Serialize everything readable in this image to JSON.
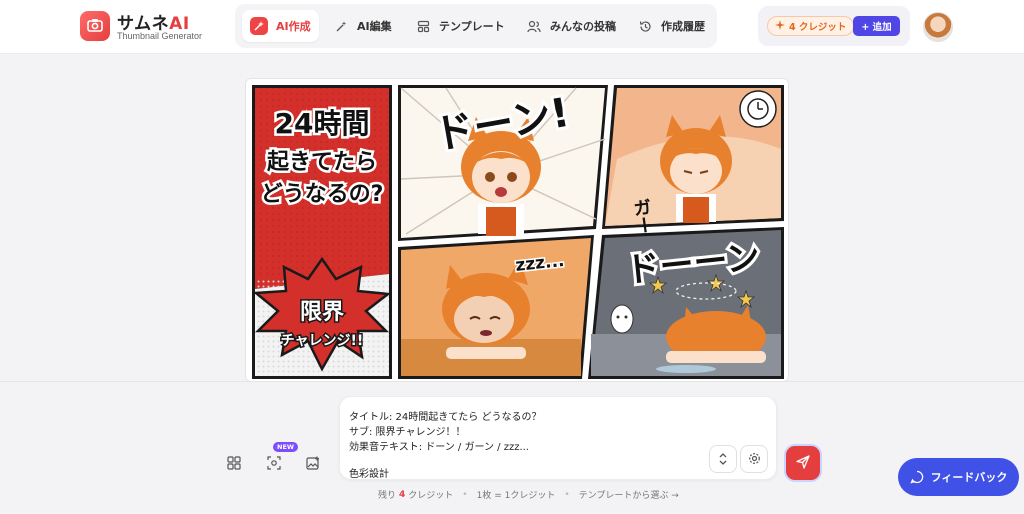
{
  "brand": {
    "title_main": "サムネ",
    "title_accent": "AI",
    "subtitle": "Thumbnail Generator",
    "logo_icon": "camera-icon",
    "accent_color": "#e53e3e"
  },
  "nav": {
    "items": [
      {
        "label": "AI作成",
        "icon": "sparkle-wand-icon",
        "active": true
      },
      {
        "label": "AI編集",
        "icon": "magic-wand-icon",
        "active": false
      },
      {
        "label": "テンプレート",
        "icon": "template-icon",
        "active": false
      },
      {
        "label": "みんなの投稿",
        "icon": "users-icon",
        "active": false
      },
      {
        "label": "作成履歴",
        "icon": "history-icon",
        "active": false
      }
    ]
  },
  "credits": {
    "label": "4 クレジット",
    "add_label": "+ 追加"
  },
  "comic": {
    "title_lines": [
      "24時間",
      "起きてたら",
      "どうなるの?"
    ],
    "burst_lines": [
      "限界",
      "チャレンジ!!"
    ],
    "sfx": {
      "panel1": "ドーン!",
      "panel2": "ガーン",
      "panel3": "zzz...",
      "panel4": "ドーーン"
    }
  },
  "prompt": {
    "lines": [
      "タイトル: 24時間起きてたら どうなるの？",
      "サブ: 限界チャレンジ！！",
      "効果音テキスト: ドーン / ガーン / zzz...",
      "",
      "色彩設計"
    ]
  },
  "tools": {
    "new_badge": "NEW"
  },
  "footer": {
    "remaining_prefix": "残り",
    "remaining_count": "4",
    "remaining_suffix": "クレジット",
    "rate": "1枚 = 1クレジット",
    "template_link": "テンプレートから選ぶ →"
  },
  "feedback": {
    "label": "フィードバック"
  }
}
